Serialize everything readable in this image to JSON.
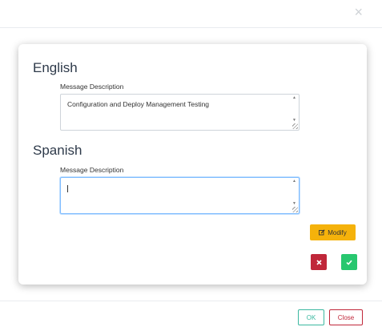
{
  "header": {
    "close_glyph": "×"
  },
  "english": {
    "title": "English",
    "label": "Message Description",
    "value": "Configuration and Deploy Management Testing"
  },
  "spanish": {
    "title": "Spanish",
    "label": "Message Description",
    "value": ""
  },
  "actions": {
    "modify_label": "Modify",
    "modify_icon": "edit-icon",
    "cancel_icon": "x-icon",
    "confirm_icon": "check-icon"
  },
  "footer": {
    "ok_label": "OK",
    "close_label": "Close"
  },
  "colors": {
    "modify": "#f5b20b",
    "cancel": "#c0273a",
    "confirm": "#28c76f",
    "ok_border": "#3bb8a0",
    "close_border": "#c0273a",
    "focus_border": "#80bdff"
  }
}
